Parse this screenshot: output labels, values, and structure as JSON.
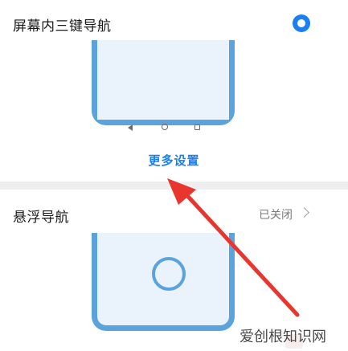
{
  "three_key_nav": {
    "title": "屏幕内三键导航",
    "selected": true,
    "more_settings": "更多设置"
  },
  "float_nav": {
    "title": "悬浮导航",
    "status": "已关闭"
  },
  "icons": {
    "radio": "radio-selected-icon",
    "nav_back": "nav-back-icon",
    "nav_home": "nav-home-icon",
    "nav_recent": "nav-recent-icon",
    "chevron": "chevron-right-icon",
    "float_button": "floating-nav-button-icon",
    "arrow": "red-arrow-annotation"
  },
  "colors": {
    "accent": "#1a7ff0",
    "phone_frame": "#5ba3dd",
    "arrow": "#e8362f"
  },
  "watermark": {
    "text": "爱创根知识网"
  }
}
